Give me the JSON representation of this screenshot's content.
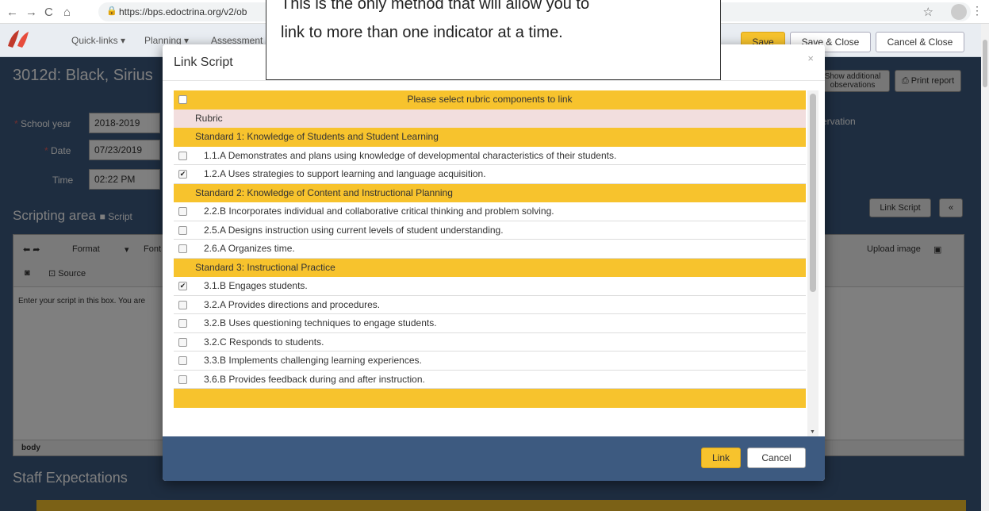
{
  "browser": {
    "url": "https://bps.edoctrina.org/v2/ob"
  },
  "navbar": {
    "menu": [
      "Quick-links ▾",
      "Planning ▾",
      "Assessment"
    ],
    "save_label": "Save",
    "save_close_label": "Save & Close",
    "cancel_close_label": "Cancel & Close"
  },
  "page": {
    "title": "3012d: Black, Sirius",
    "show_additional": "Show additional observations",
    "print_report": "Print report",
    "observation_fragment": "servation",
    "school_year_label": "School year",
    "school_year_value": "2018-2019",
    "date_label": "Date",
    "date_value": "07/23/2019",
    "time_label": "Time",
    "time_value": "02:22 PM",
    "scripting_title": "Scripting area",
    "script_toggle": "Script",
    "link_script_label": "Link Script",
    "collapse_label": "«",
    "editor": {
      "format": "Format",
      "font": "Font",
      "source": "Source",
      "upload_image": "Upload image",
      "placeholder": "Enter your script in this box.  You are",
      "status": "body"
    },
    "staff_expectations": "Staff Expectations"
  },
  "modal": {
    "title": "Link Script",
    "close": "×",
    "header_row": "Please select rubric components to link",
    "rubric_label": "Rubric",
    "rows": [
      {
        "type": "std",
        "label": "Standard 1: Knowledge of Students and Student Learning"
      },
      {
        "type": "item",
        "label": "1.1.A Demonstrates and plans using knowledge of developmental characteristics of their students.",
        "checked": false
      },
      {
        "type": "item",
        "label": "1.2.A Uses strategies to support learning and language acquisition.",
        "checked": true
      },
      {
        "type": "std",
        "label": "Standard 2: Knowledge of Content and Instructional Planning"
      },
      {
        "type": "item",
        "label": "2.2.B Incorporates individual and collaborative critical thinking and problem solving.",
        "checked": false
      },
      {
        "type": "item",
        "label": "2.5.A Designs instruction using current levels of student understanding.",
        "checked": false
      },
      {
        "type": "item",
        "label": "2.6.A Organizes time.",
        "checked": false
      },
      {
        "type": "std",
        "label": "Standard 3: Instructional Practice"
      },
      {
        "type": "item",
        "label": "3.1.B Engages students.",
        "checked": true
      },
      {
        "type": "item",
        "label": "3.2.A Provides directions and procedures.",
        "checked": false
      },
      {
        "type": "item",
        "label": "3.2.B Uses questioning techniques to engage students.",
        "checked": false
      },
      {
        "type": "item",
        "label": "3.2.C Responds to students.",
        "checked": false
      },
      {
        "type": "item",
        "label": "3.3.B Implements challenging learning experiences.",
        "checked": false
      },
      {
        "type": "item",
        "label": "3.6.B Provides feedback during and after instruction.",
        "checked": false
      }
    ],
    "link_label": "Link",
    "cancel_label": "Cancel"
  },
  "callout": {
    "line1": "This is the only method that will allow you to",
    "line2": "link to more than one indicator at a time."
  }
}
